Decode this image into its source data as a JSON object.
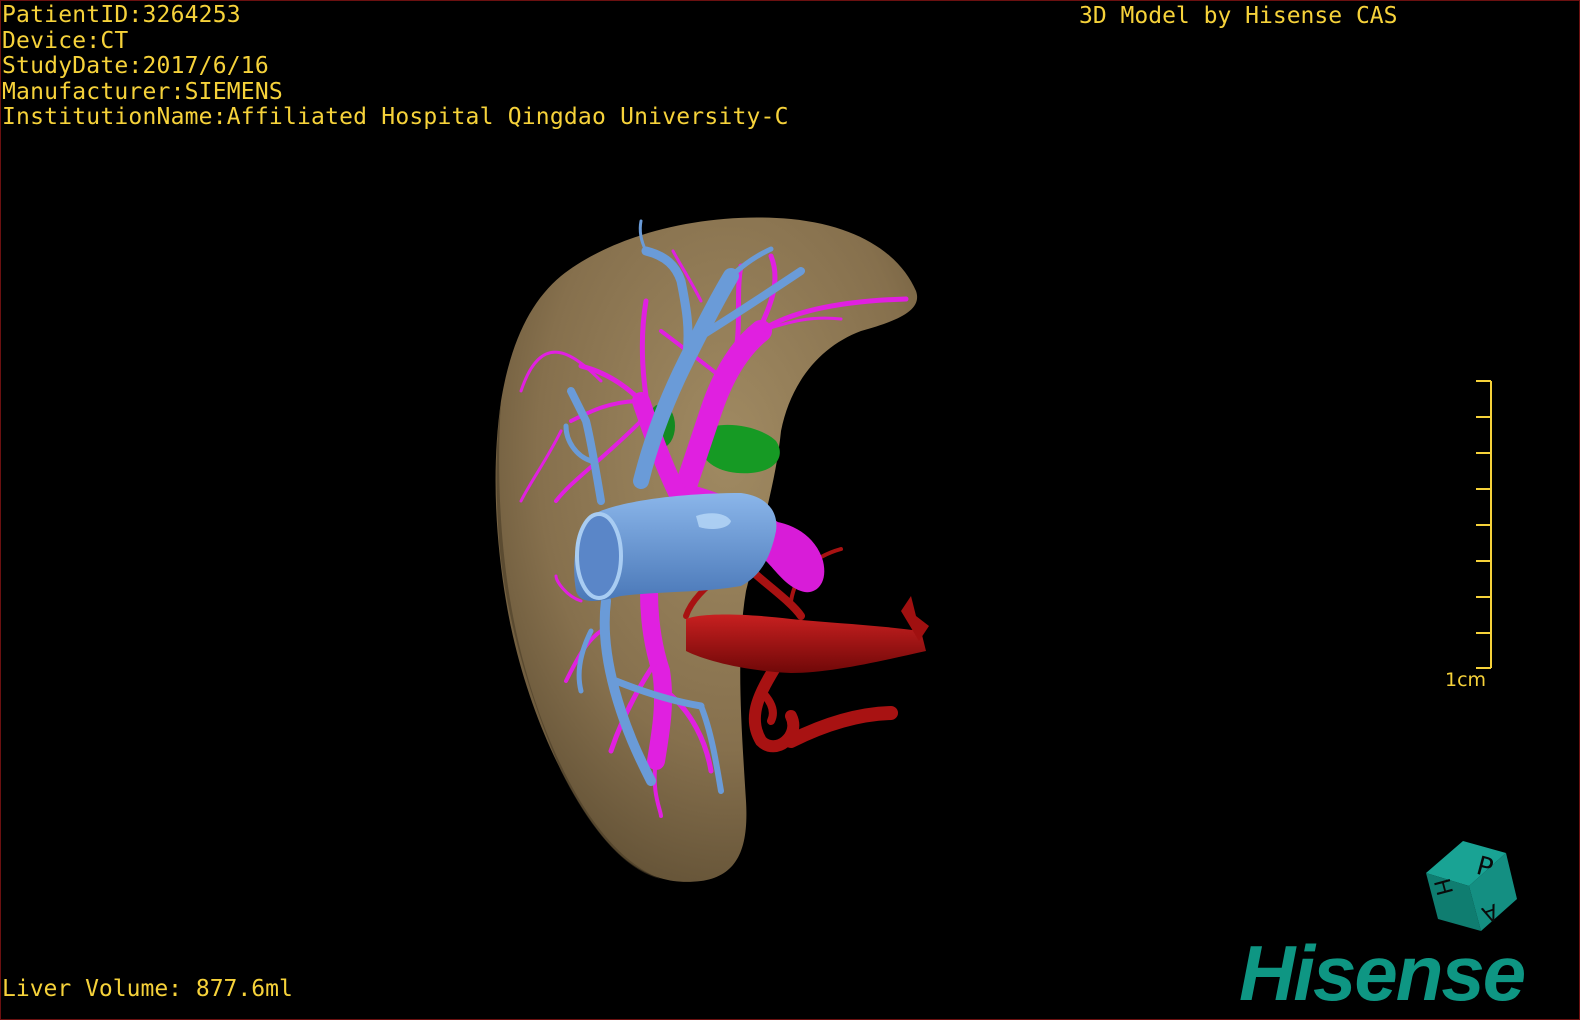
{
  "patient_info": {
    "patient_id": "PatientID:3264253",
    "device": "Device:CT",
    "study_date": "StudyDate:2017/6/16",
    "manufacturer": "Manufacturer:SIEMENS",
    "institution": "InstitutionName:Affiliated Hospital Qingdao University-C"
  },
  "title": "3D Model by Hisense CAS",
  "scale_bar": {
    "label": "1cm"
  },
  "liver_volume": "Liver Volume: 877.6ml",
  "orientation_cube": {
    "labels": [
      "P",
      "H",
      "A"
    ]
  },
  "logo": {
    "text": "Hisense"
  },
  "colors": {
    "overlay_text": "#f6d23a",
    "liver": "#8b7450",
    "portal_vein": "#e020e0",
    "hepatic_vein": "#6a9bd8",
    "artery": "#b01010",
    "gallbladder": "#10a020",
    "brand": "#0e9683"
  }
}
